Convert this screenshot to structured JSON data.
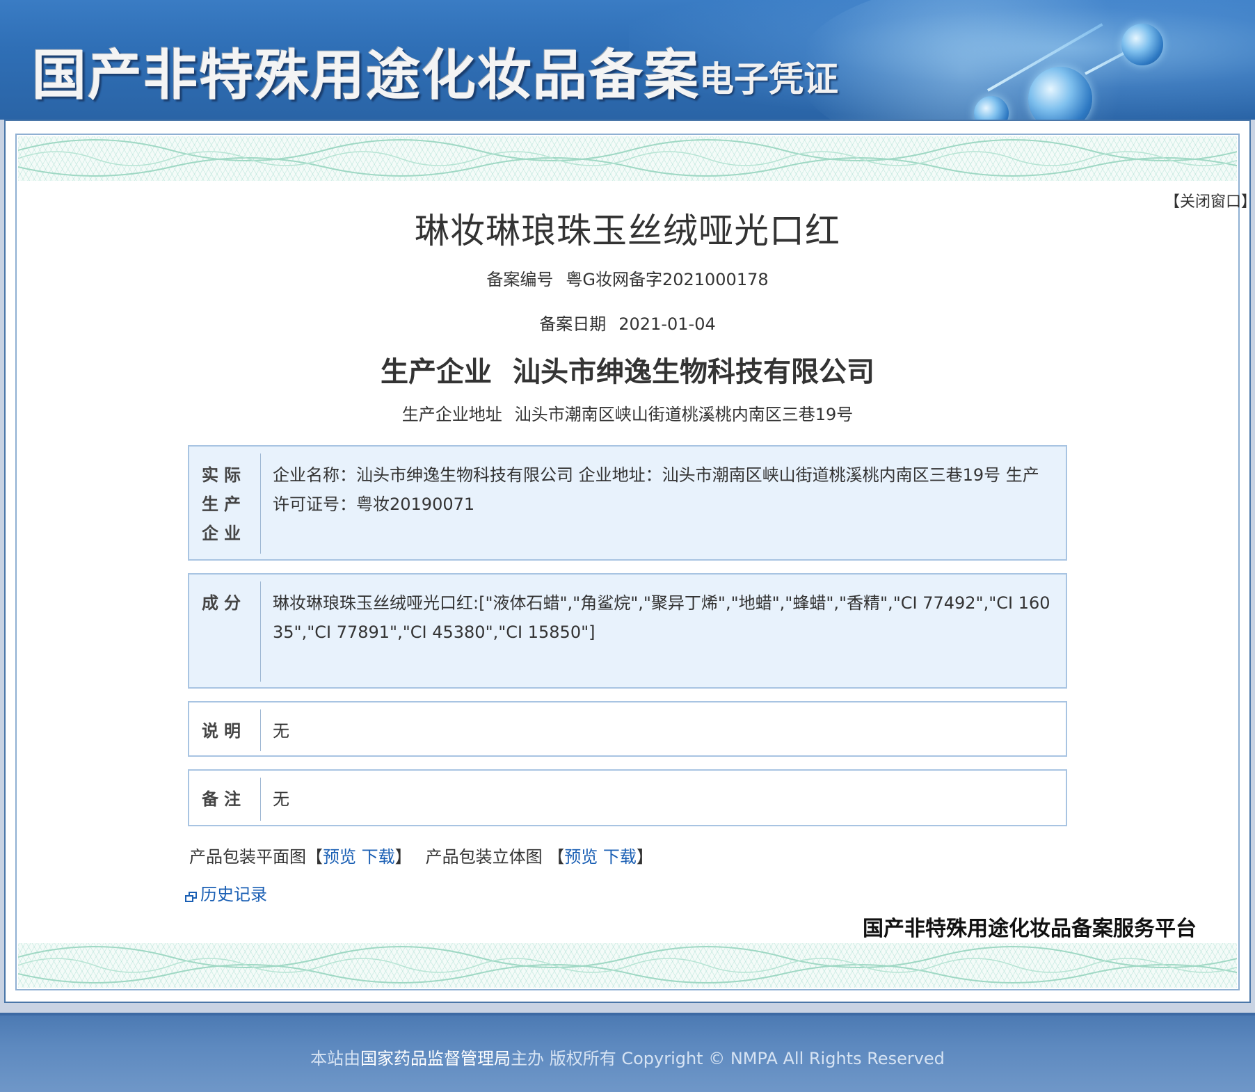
{
  "header": {
    "title": "国产非特殊用途化妆品备案",
    "subtitle": "电子凭证"
  },
  "close_window": "【关闭窗口】",
  "product": {
    "name": "琳妆琳琅珠玉丝绒哑光口红",
    "record_number_label": "备案编号",
    "record_number": "粤G妆网备字2021000178",
    "record_date_label": "备案日期",
    "record_date": "2021-01-04",
    "manufacturer_label": "生产企业",
    "manufacturer": "汕头市绅逸生物科技有限公司",
    "manufacturer_address_label": "生产企业地址",
    "manufacturer_address": "汕头市潮南区峡山街道桃溪桃内南区三巷19号"
  },
  "sections": {
    "actual_producer": {
      "label": "实际生产企业",
      "content": "企业名称：汕头市绅逸生物科技有限公司  企业地址：汕头市潮南区峡山街道桃溪桃内南区三巷19号  生产许可证号：粤妆20190071"
    },
    "ingredients": {
      "label": "成分",
      "content": "琳妆琳琅珠玉丝绒哑光口红:[\"液体石蜡\",\"角鲨烷\",\"聚异丁烯\",\"地蜡\",\"蜂蜡\",\"香精\",\"CI 77492\",\"CI 16035\",\"CI 77891\",\"CI 45380\",\"CI 15850\"]"
    },
    "description": {
      "label": "说明",
      "content": "无"
    },
    "remarks": {
      "label": "备注",
      "content": "无"
    }
  },
  "packaging": {
    "flat_label": "产品包装平面图",
    "solid_label": "产品包装立体图",
    "bracket_open": "【",
    "bracket_close": "】",
    "preview": "预览",
    "download": "下载"
  },
  "history": "历史记录",
  "platform_name": "国产非特殊用途化妆品备案服务平台",
  "footer": {
    "prefix": "本站由",
    "org": "国家药品监督管理局",
    "suffix": "主办 版权所有 Copyright © NMPA All Rights Reserved"
  }
}
